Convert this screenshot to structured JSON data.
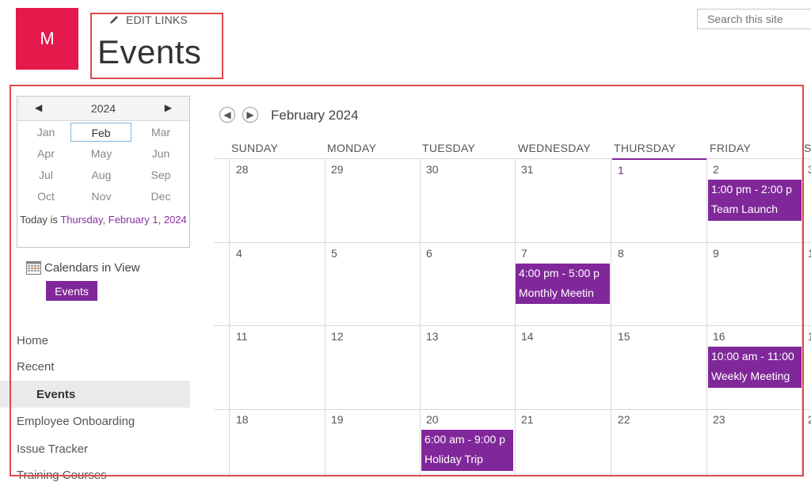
{
  "header": {
    "logo_letter": "M",
    "edit_links": "EDIT LINKS",
    "page_title": "Events",
    "search_placeholder": "Search this site"
  },
  "date_picker": {
    "year": "2024",
    "months": [
      "Jan",
      "Feb",
      "Mar",
      "Apr",
      "May",
      "Jun",
      "Jul",
      "Aug",
      "Sep",
      "Oct",
      "Nov",
      "Dec"
    ],
    "selected_month": "Feb",
    "today_prefix": "Today is ",
    "today_value": "Thursday, February 1, 2024"
  },
  "calendars_in_view": {
    "label": "Calendars in View",
    "calendar": "Events"
  },
  "nav": {
    "items": [
      "Home",
      "Recent",
      "Events",
      "Employee Onboarding",
      "Issue Tracker",
      "Training Courses"
    ]
  },
  "calendar": {
    "month_title": "February 2024",
    "weekdays": [
      "SUNDAY",
      "MONDAY",
      "TUESDAY",
      "WEDNESDAY",
      "THURSDAY",
      "FRIDAY",
      "S"
    ],
    "weeks": [
      [
        "28",
        "29",
        "30",
        "31",
        "1",
        "2",
        "3"
      ],
      [
        "4",
        "5",
        "6",
        "7",
        "8",
        "9",
        "1"
      ],
      [
        "11",
        "12",
        "13",
        "14",
        "15",
        "16",
        "1"
      ],
      [
        "18",
        "19",
        "20",
        "21",
        "22",
        "23",
        "2"
      ]
    ],
    "events": [
      {
        "time": "1:00 pm - 2:00 p",
        "title": "Team Launch"
      },
      {
        "time": "4:00 pm - 5:00 p",
        "title": "Monthly Meetin"
      },
      {
        "time": "10:00 am - 11:00",
        "title": "Weekly Meeting"
      },
      {
        "time": "6:00 am - 9:00 p",
        "title": "Holiday Trip"
      }
    ]
  },
  "colors": {
    "logo": "#e5194b",
    "accent": "#80289a",
    "highlight_border": "#e0484d"
  }
}
